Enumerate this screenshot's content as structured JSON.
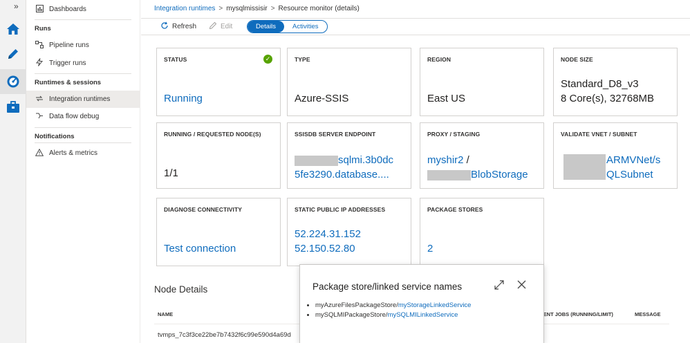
{
  "rail": {
    "expand_icon": "»"
  },
  "sidebar": {
    "dashboards": "Dashboards",
    "runs_header": "Runs",
    "pipeline_runs": "Pipeline runs",
    "trigger_runs": "Trigger runs",
    "runtimes_header": "Runtimes & sessions",
    "integration_runtimes": "Integration runtimes",
    "data_flow_debug": "Data flow debug",
    "notifications_header": "Notifications",
    "alerts_metrics": "Alerts & metrics"
  },
  "breadcrumb": {
    "root": "Integration runtimes",
    "runtime": "mysqlmissisir",
    "page": "Resource monitor (details)"
  },
  "toolbar": {
    "refresh": "Refresh",
    "edit": "Edit",
    "tab_details": "Details",
    "tab_activities": "Activities"
  },
  "cards": {
    "status": {
      "label": "STATUS",
      "value": "Running"
    },
    "type": {
      "label": "TYPE",
      "value": "Azure-SSIS"
    },
    "region": {
      "label": "REGION",
      "value": "East US"
    },
    "node_size": {
      "label": "NODE SIZE",
      "value1": "Standard_D8_v3",
      "value2": "8 Core(s), 32768MB"
    },
    "nodes": {
      "label": "RUNNING / REQUESTED NODE(S)",
      "value": "1/1"
    },
    "ssisdb": {
      "label": "SSISDB SERVER ENDPOINT",
      "value1": "sqlmi.3b0dc",
      "value2": "5fe3290.database...."
    },
    "proxy": {
      "label": "PROXY / STAGING",
      "value1": "myshir2",
      "slash": " /",
      "value2": "BlobStorage"
    },
    "vnet": {
      "label": "VALIDATE VNET / SUBNET",
      "value1": "ARMVNet/s",
      "value2": "QLSubnet"
    },
    "diagnose": {
      "label": "DIAGNOSE CONNECTIVITY",
      "value": "Test connection"
    },
    "static_ip": {
      "label": "STATIC PUBLIC IP ADDRESSES",
      "value1": "52.224.31.152",
      "value2": "52.150.52.80"
    },
    "package_stores": {
      "label": "PACKAGE STORES",
      "value": "2"
    }
  },
  "node_details": {
    "title": "Node Details",
    "columns": {
      "name": "NAME",
      "jobs": "CURRENT JOBS (RUNNING/LIMIT)",
      "message": "MESSAGE"
    },
    "row_name": "tvmps_7c3f3ce22be7b7432f6c99e590d4a69d"
  },
  "popup": {
    "title": "Package store/linked service names",
    "items": [
      {
        "store": "myAzureFilesPackageStore/",
        "link": "myStorageLinkedService"
      },
      {
        "store": "mySQLMIPackageStore/",
        "link": "mySQLMILinkedService"
      }
    ]
  },
  "colors": {
    "accent": "#0f6cbd",
    "success": "#57a300",
    "redacted": "#c8c8c8"
  }
}
